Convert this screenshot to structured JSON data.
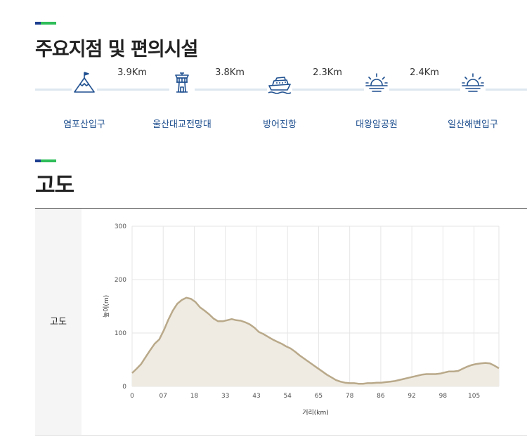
{
  "sections": {
    "facilities_title": "주요지점 및 편의시설",
    "elevation_title": "고도"
  },
  "route": {
    "stops": [
      {
        "label": "염포산입구",
        "icon": "mountain-flag-icon"
      },
      {
        "label": "울산대교전망대",
        "icon": "observatory-tower-icon"
      },
      {
        "label": "방어진항",
        "icon": "ship-icon"
      },
      {
        "label": "대왕암공원",
        "icon": "sunrise-icon"
      },
      {
        "label": "일산해변입구",
        "icon": "sunrise-icon"
      }
    ],
    "distances": [
      "3.9Km",
      "3.8Km",
      "2.3Km",
      "2.4Km"
    ]
  },
  "elevation_panel": {
    "header": "고도"
  },
  "colors": {
    "accent_blue": "#1b3d8f",
    "accent_green": "#2ebd59",
    "icon_blue": "#1e4f8f",
    "area_fill": "#efebe2",
    "line": "#b9a98a"
  },
  "chart_data": {
    "type": "area",
    "xlabel": "거리(km)",
    "ylabel": "높이(m)",
    "ylim": [
      0,
      300
    ],
    "yticks": [
      0,
      100,
      200,
      300
    ],
    "xticks": [
      "0",
      "07",
      "18",
      "33",
      "43",
      "54",
      "65",
      "78",
      "86",
      "92",
      "98",
      "105"
    ],
    "grid": true,
    "series": [
      {
        "values": [
          25,
          33,
          42,
          55,
          68,
          80,
          88,
          105,
          125,
          142,
          155,
          162,
          166,
          164,
          158,
          148,
          142,
          135,
          127,
          122,
          122,
          124,
          126,
          124,
          123,
          120,
          116,
          110,
          102,
          98,
          93,
          88,
          84,
          80,
          75,
          71,
          65,
          58,
          52,
          46,
          40,
          34,
          28,
          22,
          17,
          12,
          9,
          7,
          6,
          6,
          5,
          5,
          6,
          6,
          7,
          7,
          8,
          9,
          10,
          12,
          14,
          16,
          18,
          20,
          22,
          23,
          23,
          23,
          24,
          26,
          28,
          28,
          29,
          33,
          37,
          40,
          42,
          43,
          44,
          43,
          39,
          34
        ]
      }
    ]
  }
}
